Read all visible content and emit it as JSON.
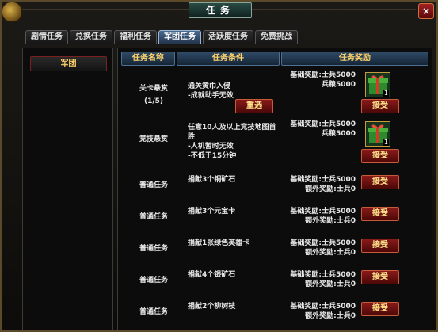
{
  "window": {
    "title": "任务",
    "close_symbol": "×"
  },
  "tabs": [
    {
      "label": "剧情任务",
      "active": false
    },
    {
      "label": "兑换任务",
      "active": false
    },
    {
      "label": "福利任务",
      "active": false
    },
    {
      "label": "军团任务",
      "active": true
    },
    {
      "label": "活跃度任务",
      "active": false
    },
    {
      "label": "免费挑战",
      "active": false
    }
  ],
  "sidebar": {
    "item_label": "军团"
  },
  "table": {
    "headers": {
      "name": "任务名称",
      "condition": "任务条件",
      "reward": "任务奖励"
    },
    "rows": [
      {
        "name": "关卡悬赏",
        "progress": "(1/5)",
        "condition": "通关黄巾入侵\n-成就助手无效",
        "reward1": "基础奖励:士兵5000",
        "reward2": "兵粮5000",
        "reroll_label": "重选",
        "accept_label": "接受",
        "item_count": "1",
        "has_item": true
      },
      {
        "name": "竞技悬赏",
        "progress": "",
        "condition": "任意10人及以上竞技地图首胜\n-人机暂时无效\n-不低于15分钟",
        "reward1": "基础奖励:士兵5000",
        "reward2": "兵粮5000",
        "accept_label": "接受",
        "item_count": "1",
        "has_item": true
      },
      {
        "name": "普通任务",
        "progress": "",
        "condition": "捐献3个铜矿石",
        "reward1": "基础奖励:士兵5000",
        "reward2": "额外奖励:士兵0",
        "accept_label": "接受",
        "has_item": false
      },
      {
        "name": "普通任务",
        "progress": "",
        "condition": "捐献3个元宝卡",
        "reward1": "基础奖励:士兵5000",
        "reward2": "额外奖励:士兵0",
        "accept_label": "接受",
        "has_item": false
      },
      {
        "name": "普通任务",
        "progress": "",
        "condition": "捐献1张绿色英雄卡",
        "reward1": "基础奖励:士兵5000",
        "reward2": "额外奖励:士兵0",
        "accept_label": "接受",
        "has_item": false
      },
      {
        "name": "普通任务",
        "progress": "",
        "condition": "捐献4个银矿石",
        "reward1": "基础奖励:士兵5000",
        "reward2": "额外奖励:士兵0",
        "accept_label": "接受",
        "has_item": false
      },
      {
        "name": "普通任务",
        "progress": "",
        "condition": "捐献2个柳树枝",
        "reward1": "基础奖励:士兵5000",
        "reward2": "额外奖励:士兵0",
        "accept_label": "接受",
        "has_item": false
      }
    ]
  }
}
